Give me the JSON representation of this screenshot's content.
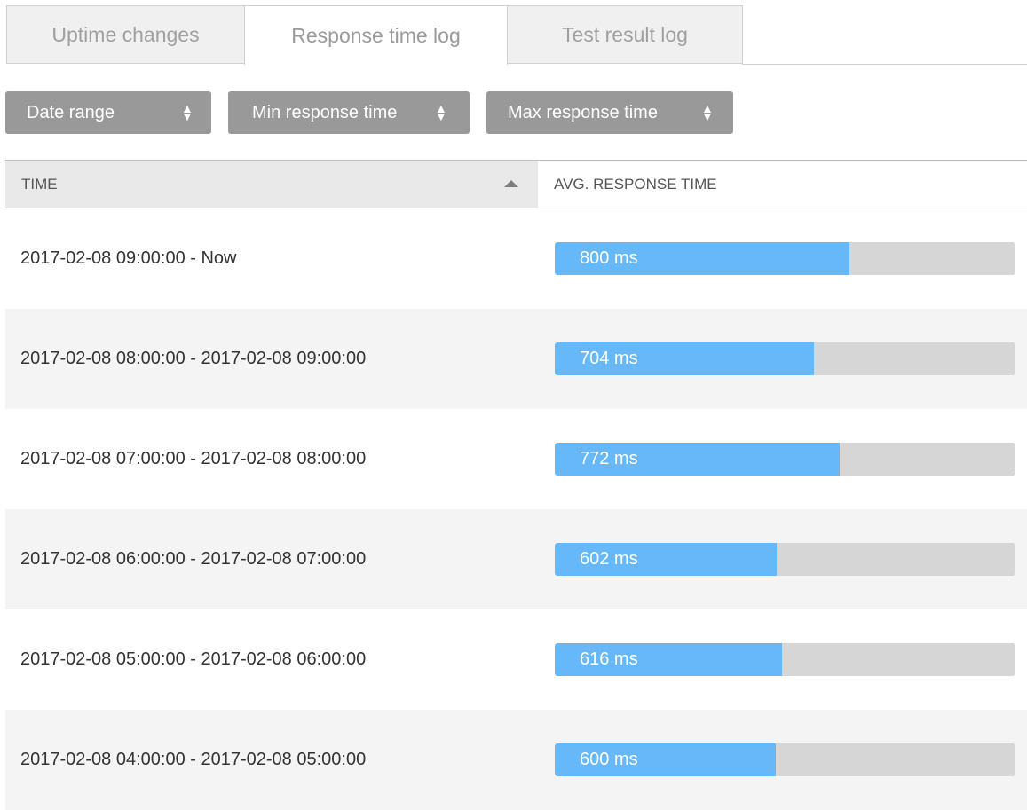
{
  "tabs": [
    {
      "label": "Uptime changes",
      "active": false
    },
    {
      "label": "Response time log",
      "active": true
    },
    {
      "label": "Test result log",
      "active": false
    }
  ],
  "filters": {
    "date_range": "Date range",
    "min_response": "Min response time",
    "max_response": "Max response time",
    "caret_icon": "up-down-caret-icon"
  },
  "table": {
    "headers": {
      "time": "TIME",
      "avg": "AVG. RESPONSE TIME"
    },
    "sort": {
      "column": "time",
      "direction": "ascending-arrow-icon"
    },
    "max_scale_ms": 1250,
    "rows": [
      {
        "time": "2017-02-08 09:00:00 - Now",
        "avg_label": "800 ms",
        "avg_ms": 800
      },
      {
        "time": "2017-02-08 08:00:00 - 2017-02-08 09:00:00",
        "avg_label": "704 ms",
        "avg_ms": 704
      },
      {
        "time": "2017-02-08 07:00:00 - 2017-02-08 08:00:00",
        "avg_label": "772 ms",
        "avg_ms": 772
      },
      {
        "time": "2017-02-08 06:00:00 - 2017-02-08 07:00:00",
        "avg_label": "602 ms",
        "avg_ms": 602
      },
      {
        "time": "2017-02-08 05:00:00 - 2017-02-08 06:00:00",
        "avg_label": "616 ms",
        "avg_ms": 616
      },
      {
        "time": "2017-02-08 04:00:00 - 2017-02-08 05:00:00",
        "avg_label": "600 ms",
        "avg_ms": 600
      }
    ]
  },
  "colors": {
    "bar_fill": "#66b8f8",
    "bar_track": "#d6d6d6",
    "filter_bg": "#999999"
  }
}
